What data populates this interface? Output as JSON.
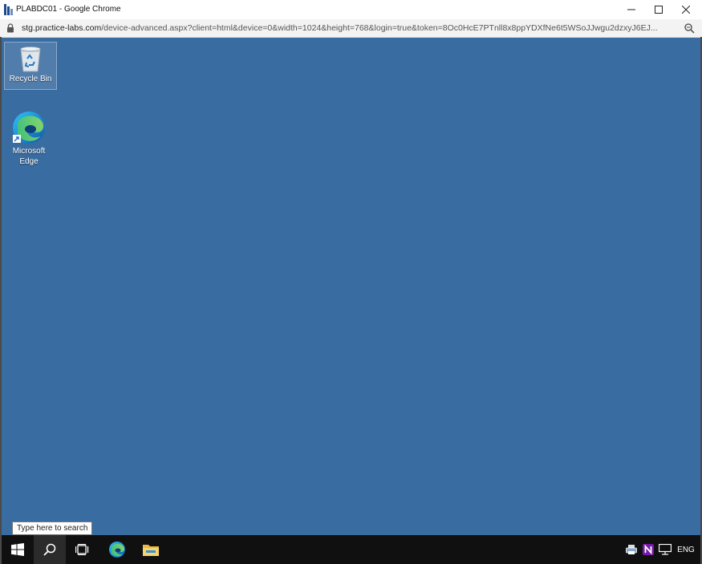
{
  "window": {
    "title": "PLABDC01 - Google Chrome",
    "controls": [
      "minimize",
      "maximize",
      "close"
    ]
  },
  "address_bar": {
    "host": "stg.practice-labs.com",
    "path": "/device-advanced.aspx?client=html&device=0&width=1024&height=768&login=true&token=8Oc0HcE7PTnll8x8ppYDXfNe6t5WSoJJwgu2dzxyJ6EJ..."
  },
  "desktop": {
    "background_color": "#396ca1",
    "icons": [
      {
        "label": "Recycle Bin",
        "icon": "recycle-bin-icon"
      },
      {
        "label": "Microsoft Edge",
        "icon": "edge-icon"
      }
    ]
  },
  "tooltip": {
    "text": "Type here to search"
  },
  "taskbar": {
    "buttons": [
      "start-icon",
      "search-icon",
      "task-view-icon",
      "edge-icon",
      "file-explorer-icon"
    ],
    "tray": {
      "icons": [
        "printer-icon",
        "onenote-icon",
        "network-icon"
      ],
      "language": "ENG"
    }
  }
}
